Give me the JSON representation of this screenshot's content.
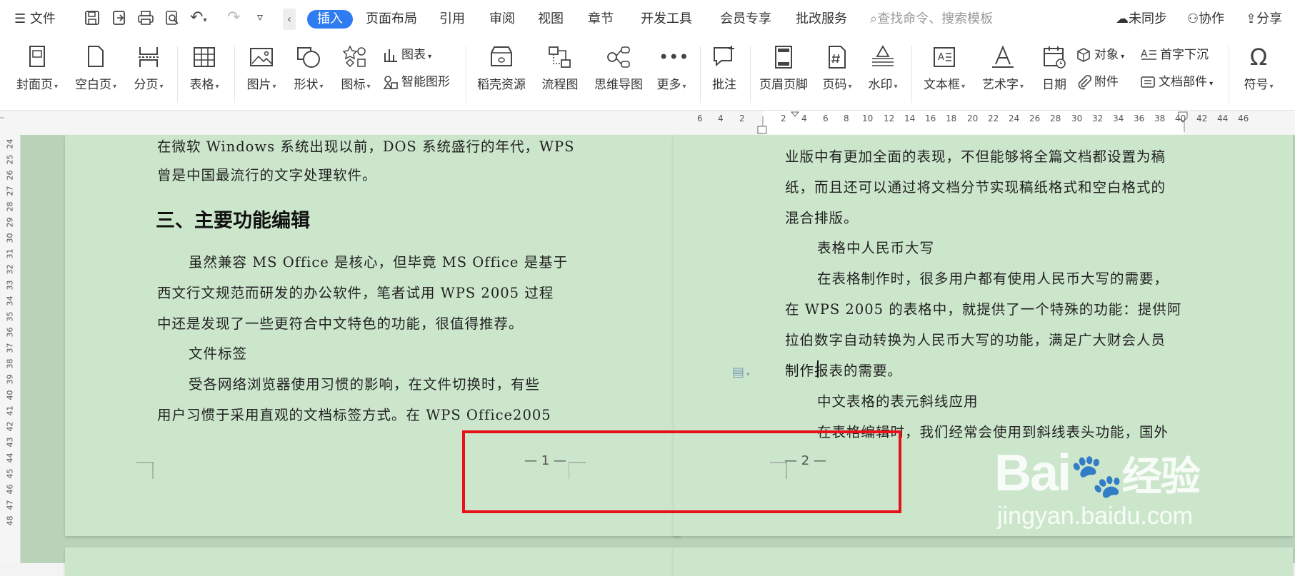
{
  "menu": {
    "file": "文件",
    "tabs": [
      "插入",
      "页面布局",
      "引用",
      "审阅",
      "视图",
      "章节",
      "开发工具",
      "会员专享",
      "批改服务"
    ],
    "search_placeholder": "查找命令、搜索模板",
    "sync": "未同步",
    "collab": "协作",
    "share": "分享"
  },
  "ribbon": {
    "cover": "封面页",
    "blank": "空白页",
    "break": "分页",
    "table": "表格",
    "picture": "图片",
    "shape": "形状",
    "icon": "图标",
    "chart": "图表",
    "smart": "智能图形",
    "resource": "稻壳资源",
    "flow": "流程图",
    "mind": "思维导图",
    "more": "更多",
    "comment": "批注",
    "headerfooter": "页眉页脚",
    "pagenum": "页码",
    "watermark": "水印",
    "textbox": "文本框",
    "wordart": "艺术字",
    "date": "日期",
    "object": "对象",
    "attach": "附件",
    "dropcap": "首字下沉",
    "docpart": "文档部件",
    "symbol": "符号"
  },
  "ruler": {
    "h": [
      "6",
      "4",
      "2",
      "2",
      "4",
      "6",
      "8",
      "10",
      "12",
      "14",
      "16",
      "18",
      "20",
      "22",
      "24",
      "26",
      "28",
      "30",
      "32",
      "34",
      "36",
      "38",
      "40",
      "42",
      "44",
      "46"
    ],
    "v": [
      "24",
      "25",
      "26",
      "27",
      "28",
      "29",
      "30",
      "31",
      "32",
      "33",
      "34",
      "35",
      "36",
      "37",
      "38",
      "39",
      "40",
      "41",
      "42",
      "43",
      "44",
      "45",
      "46",
      "47",
      "48"
    ]
  },
  "page1": {
    "line1": "在微软 Windows 系统出现以前，DOS 系统盛行的年代，WPS",
    "line2": "曾是中国最流行的文字处理软件。",
    "heading": "三、主要功能编辑",
    "line3": "虽然兼容 MS Office 是核心，但毕竟 MS Office 是基于",
    "line4": "西文行文规范而研发的办公软件，笔者试用 WPS 2005 过程",
    "line5": "中还是发现了一些更符合中文特色的功能，很值得推荐。",
    "line6": "文件标签",
    "line7": "受各网络浏览器使用习惯的影响，在文件切换时，有些",
    "line8": "用户习惯于采用直观的文档标签方式。在 WPS Office2005",
    "page_number": "— 1 —"
  },
  "page2": {
    "line1": "业版中有更加全面的表现，不但能够将全篇文档都设置为稿",
    "line2": "纸，而且还可以通过将文档分节实现稿纸格式和空白格式的",
    "line3": "混合排版。",
    "line4": "表格中人民币大写",
    "line5": "在表格制作时，很多用户都有使用人民币大写的需要，",
    "line6": "在 WPS 2005 的表格中，就提供了一个特殊的功能：提供阿",
    "line7": "拉伯数字自动转换为人民币大写的功能，满足广大财会人员",
    "line8": "制作报表的需要。",
    "line9": "中文表格的表元斜线应用",
    "line10": "在表格编辑时，我们经常会使用到斜线表头功能，国外",
    "page_number": "— 2 —"
  },
  "watermark": {
    "brand": "Bai",
    "brand2": "经验",
    "url": "jingyan.baidu.com"
  },
  "colors": {
    "accent": "#2f7bf2",
    "page": "#cce6cc",
    "highlight_box": "#e8111a"
  }
}
